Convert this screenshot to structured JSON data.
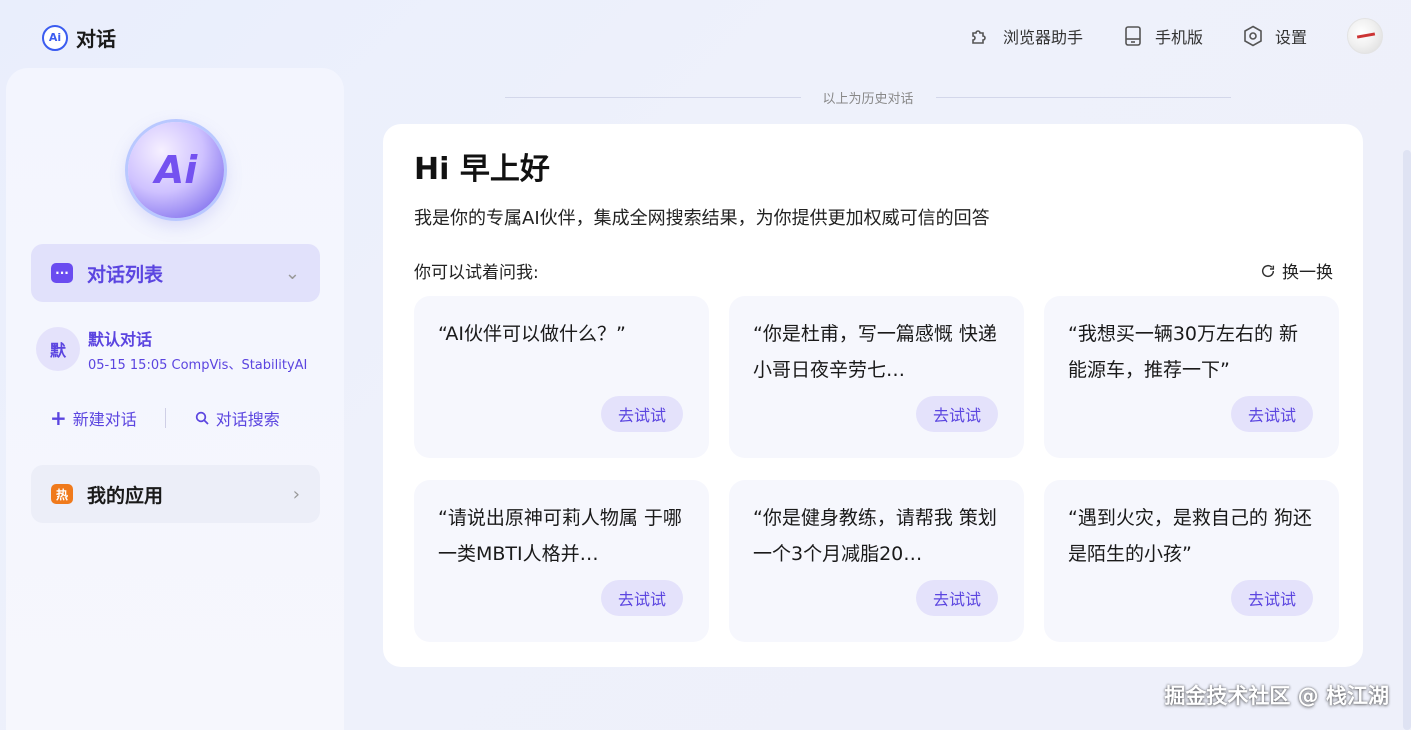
{
  "header": {
    "brand_logo": "Ai",
    "brand_title": "对话",
    "actions": [
      {
        "label": "浏览器助手",
        "icon": "puzzle-icon"
      },
      {
        "label": "手机版",
        "icon": "mobile-icon"
      },
      {
        "label": "设置",
        "icon": "gear-icon"
      }
    ],
    "avatar": "user-avatar"
  },
  "sidebar": {
    "orb_text": "Ai",
    "chat_list": {
      "label": "对话列表",
      "icon": "chat-bubble-icon"
    },
    "conversations": [
      {
        "avatar": "默",
        "title": "默认对话",
        "meta": "05-15 15:05   CompVis、StabilityAI"
      }
    ],
    "new_chat": "新建对话",
    "search_chat": "对话搜索",
    "apps": {
      "label": "我的应用",
      "icon_text": "热"
    }
  },
  "history_label": "以上为历史对话",
  "main": {
    "greeting": "Hi 早上好",
    "intro": "我是你的专属AI伙伴，集成全网搜索结果，为你提供更加权威可信的回答",
    "try_label": "你可以试着问我:",
    "refresh_label": "换一换",
    "prompts": [
      {
        "text": "“AI伙伴可以做什么？”",
        "button": "去试试"
      },
      {
        "text": "“你是杜甫，写一篇感慨 快递小哥日夜辛劳七…",
        "button": "去试试"
      },
      {
        "text": "“我想买一辆30万左右的 新能源车，推荐一下”",
        "button": "去试试"
      },
      {
        "text": "“请说出原神可莉人物属 于哪一类MBTI人格并…",
        "button": "去试试"
      },
      {
        "text": "“你是健身教练，请帮我 策划一个3个月减脂20…",
        "button": "去试试"
      },
      {
        "text": "“遇到火灾，是救自己的 狗还是陌生的小孩”",
        "button": "去试试"
      }
    ]
  },
  "footer_mark": "掘金技术社区 @ 栈江湖",
  "colors": {
    "accent": "#5b45e0",
    "accent_bg": "#e4e2fb",
    "hot": "#f07a1c"
  }
}
